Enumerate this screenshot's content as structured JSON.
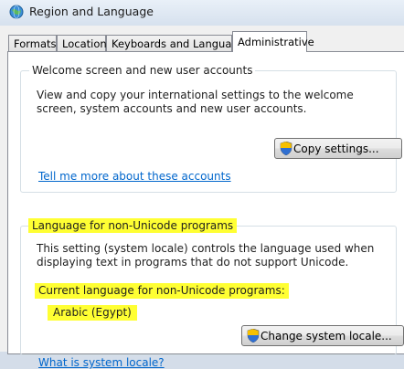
{
  "window": {
    "title": "Region and Language",
    "icon": "globe-icon"
  },
  "tabs": [
    {
      "label": "Formats",
      "active": false
    },
    {
      "label": "Location",
      "active": false
    },
    {
      "label": "Keyboards and Languages",
      "active": false
    },
    {
      "label": "Administrative",
      "active": true
    }
  ],
  "welcome_group": {
    "title": "Welcome screen and new user accounts",
    "description": "View and copy your international settings to the welcome screen, system accounts and new user accounts.",
    "copy_button": "Copy settings...",
    "help_link": "Tell me more about these accounts"
  },
  "nonunicode_group": {
    "title": "Language for non-Unicode programs",
    "description": "This setting (system locale) controls the language used when displaying text in programs that do not support Unicode.",
    "current_label": "Current language for non-Unicode programs:",
    "current_value": "Arabic (Egypt)",
    "change_button": "Change system locale...",
    "help_link": "What is system locale?"
  },
  "colors": {
    "highlight": "#ffff33",
    "link": "#0066cc"
  }
}
